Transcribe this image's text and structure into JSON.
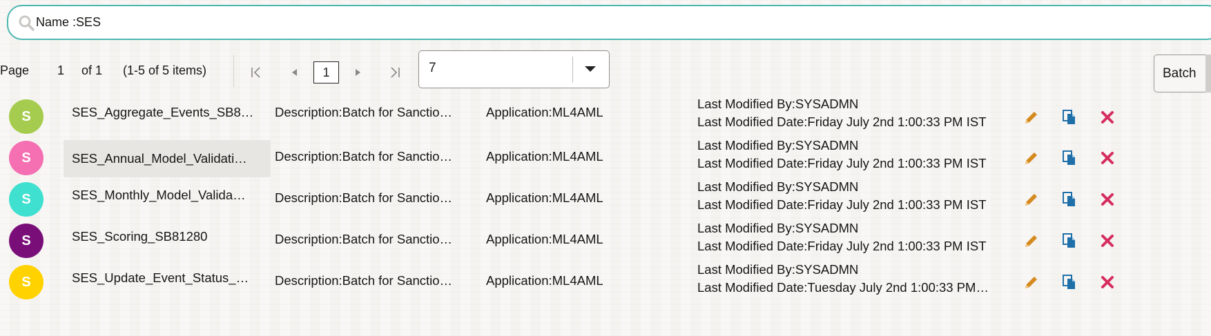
{
  "search": {
    "text": "Name :SES"
  },
  "pagination": {
    "page_label": "Page",
    "current_page": "1",
    "of_label": "of 1",
    "items_label": "(1-5 of 5 items)",
    "page_box": "1"
  },
  "page_size_select": {
    "value": "7"
  },
  "batch_button": {
    "label": "Batch"
  },
  "rows": [
    {
      "avatar_letter": "S",
      "avatar_color": "#a6cc4f",
      "name": "SES_Aggregate_Events_SB8…",
      "description": "Description:Batch for Sanctio…",
      "application": "Application:ML4AML",
      "modified_by": "Last Modified By:SYSADMN",
      "modified_date": "Last Modified Date:Friday July 2nd 1:00:33 PM IST"
    },
    {
      "avatar_letter": "S",
      "avatar_color": "#f56fb3",
      "name": "SES_Annual_Model_Validati…",
      "description": "Description:Batch for Sanctio…",
      "application": "Application:ML4AML",
      "modified_by": "Last Modified By:SYSADMN",
      "modified_date": "Last Modified Date:Friday July 2nd 1:00:33 PM IST"
    },
    {
      "avatar_letter": "S",
      "avatar_color": "#3fe0cf",
      "name": "SES_Monthly_Model_Valida…",
      "description": "Description:Batch for Sanctio…",
      "application": "Application:ML4AML",
      "modified_by": "Last Modified By:SYSADMN",
      "modified_date": "Last Modified Date:Friday July 2nd 1:00:33 PM IST"
    },
    {
      "avatar_letter": "S",
      "avatar_color": "#7a0e79",
      "name": "SES_Scoring_SB81280",
      "description": "Description:Batch for Sanctio…",
      "application": "Application:ML4AML",
      "modified_by": "Last Modified By:SYSADMN",
      "modified_date": "Last Modified Date:Friday July 2nd 1:00:33 PM IST"
    },
    {
      "avatar_letter": "S",
      "avatar_color": "#ffd200",
      "name": "SES_Update_Event_Status_…",
      "description": "Description:Batch for Sanctio…",
      "application": "Application:ML4AML",
      "modified_by": "Last Modified By:SYSADMN",
      "modified_date": "Last Modified Date:Tuesday July 2nd 1:00:33 PM…"
    }
  ],
  "colors": {
    "accent": "#4bb6b0",
    "edit_icon": "#d48a1e",
    "copy_icon": "#1f6fa8",
    "delete_icon": "#d62d5e"
  },
  "icons": {
    "search": "search-icon",
    "first": "first-page-icon",
    "prev": "previous-page-icon",
    "next": "next-page-icon",
    "last": "last-page-icon",
    "dropdown": "chevron-down-icon",
    "edit": "pencil-icon",
    "copy": "copy-icon",
    "delete": "delete-icon"
  }
}
